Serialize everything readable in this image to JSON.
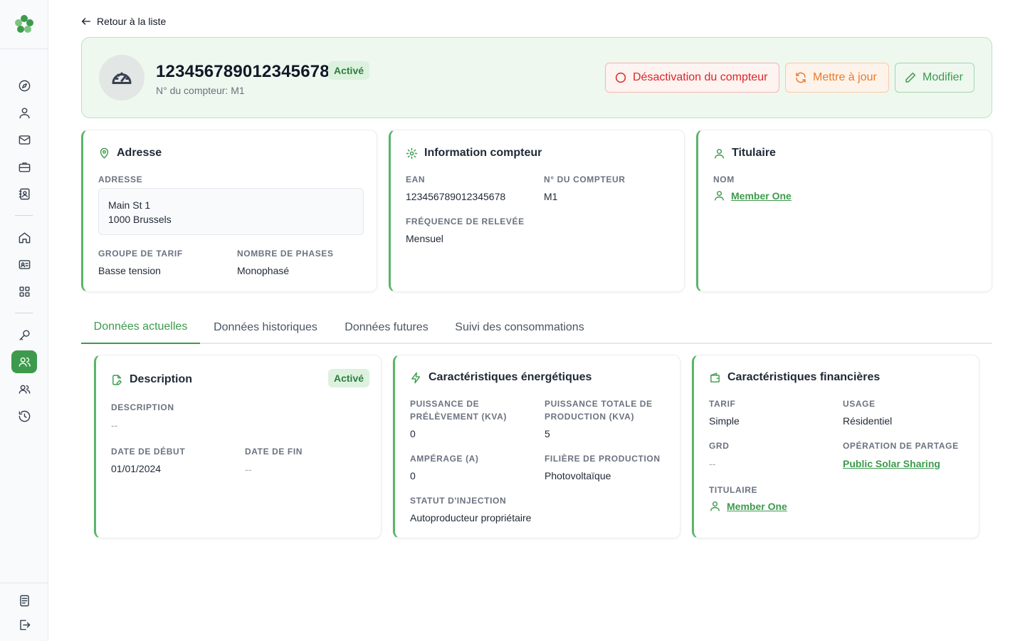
{
  "back": {
    "label": "Retour à la liste"
  },
  "header": {
    "title": "123456789012345678",
    "status": "Activé",
    "subtitle": "N° du compteur: M1",
    "buttons": {
      "deactivate": "Désactivation du compteur",
      "update": "Mettre à jour",
      "edit": "Modifier"
    }
  },
  "address_card": {
    "title": "Adresse",
    "address_label": "ADRESSE",
    "address_line1": "Main St 1",
    "address_line2": "1000 Brussels",
    "tariff_group_label": "GROUPE DE TARIF",
    "tariff_group": "Basse tension",
    "phases_label": "NOMBRE DE PHASES",
    "phases": "Monophasé"
  },
  "meter_card": {
    "title": "Information compteur",
    "ean_label": "EAN",
    "ean": "123456789012345678",
    "meter_no_label": "N° DU COMPTEUR",
    "meter_no": "M1",
    "frequency_label": "FRÉQUENCE DE RELEVÉE",
    "frequency": "Mensuel"
  },
  "holder_card": {
    "title": "Titulaire",
    "name_label": "NOM",
    "name": "Member One"
  },
  "tabs": [
    {
      "label": "Données actuelles"
    },
    {
      "label": "Données historiques"
    },
    {
      "label": "Données futures"
    },
    {
      "label": "Suivi des consommations"
    }
  ],
  "description_card": {
    "title": "Description",
    "status": "Activé",
    "description_label": "DESCRIPTION",
    "description": "--",
    "start_label": "DATE DE DÉBUT",
    "start": "01/01/2024",
    "end_label": "DATE DE FIN",
    "end": "--"
  },
  "energy_card": {
    "title": "Caractéristiques énergétiques",
    "withdrawal_label_1": "PUISSANCE DE",
    "withdrawal_label_2": "PRÉLÈVEMENT (KVA)",
    "withdrawal": "0",
    "production_label_1": "PUISSANCE TOTALE DE",
    "production_label_2": "PRODUCTION (KVA)",
    "production": "5",
    "amperage_label": "AMPÉRAGE (A)",
    "amperage": "0",
    "sector_label": "FILIÈRE DE PRODUCTION",
    "sector": "Photovoltaïque",
    "injection_label": "STATUT D'INJECTION",
    "injection": "Autoproducteur propriétaire"
  },
  "finance_card": {
    "title": "Caractéristiques financières",
    "tariff_label": "TARIF",
    "tariff": "Simple",
    "usage_label": "USAGE",
    "usage": "Résidentiel",
    "grd_label": "GRD",
    "grd": "--",
    "sharing_label": "OPÉRATION DE PARTAGE",
    "sharing": "Public Solar Sharing",
    "holder_label": "TITULAIRE",
    "holder": "Member One"
  },
  "colors": {
    "accent": "#3d9a4d",
    "danger": "#dc2626",
    "warning": "#ea7a2b",
    "header_bg": "#eef8ef"
  }
}
